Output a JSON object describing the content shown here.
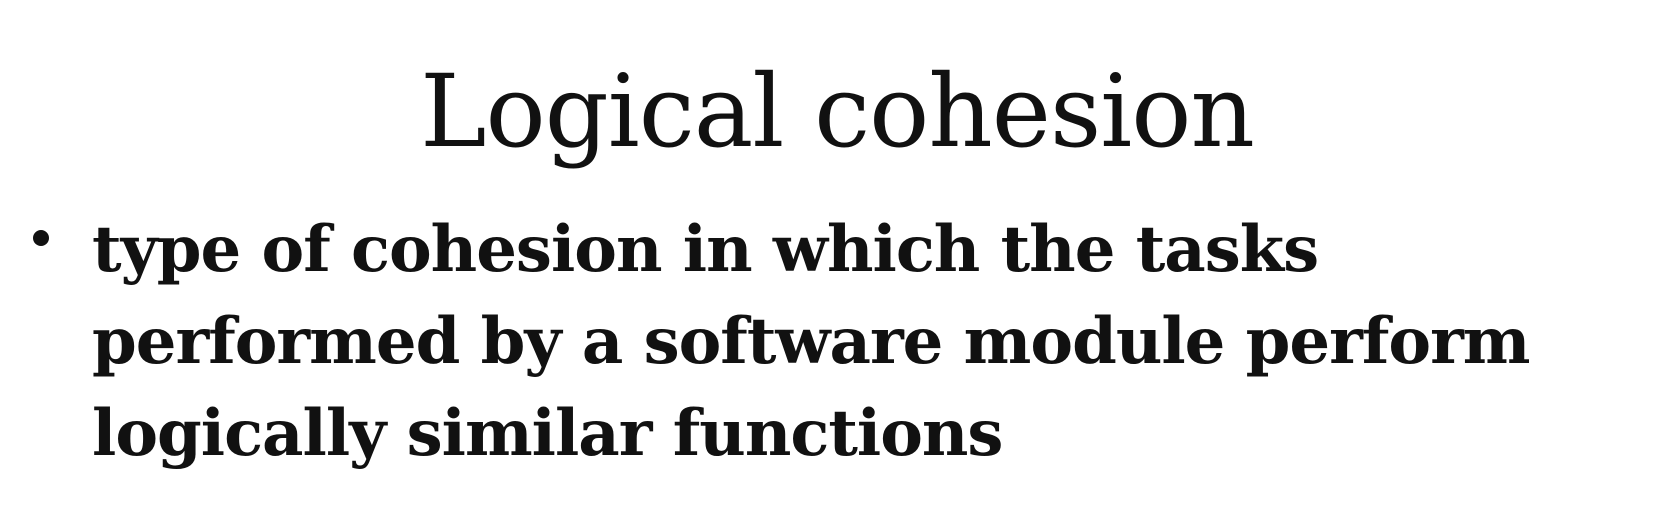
{
  "slide": {
    "title": "Logical cohesion",
    "bullets": [
      {
        "text": "type of cohesion in which the tasks performed by a software module perform logically similar functions"
      }
    ]
  },
  "colors": {
    "background": "#ffffff",
    "text": "#111111"
  }
}
